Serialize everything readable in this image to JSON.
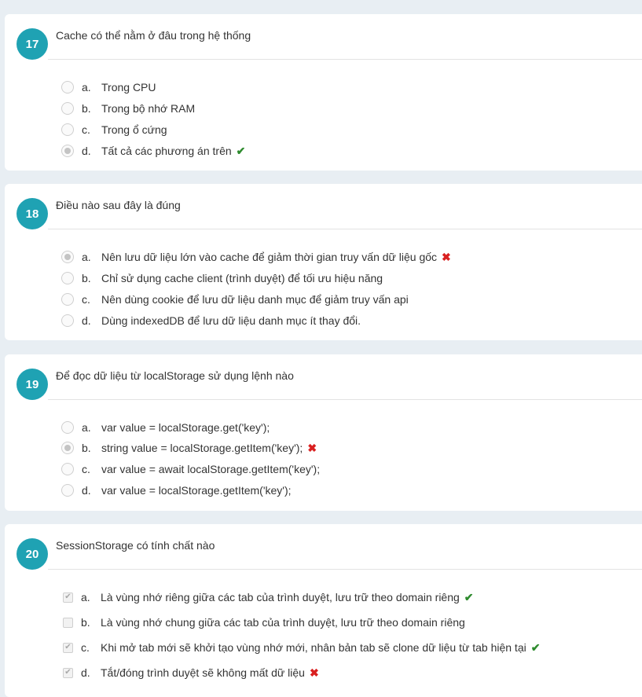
{
  "questions": [
    {
      "number": "17",
      "text": "Cache có thể nằm ở đâu trong hệ thống",
      "type": "radio",
      "options": [
        {
          "letter": "a.",
          "text": "Trong CPU",
          "checked": false,
          "mark": ""
        },
        {
          "letter": "b.",
          "text": "Trong bộ nhớ RAM",
          "checked": false,
          "mark": ""
        },
        {
          "letter": "c.",
          "text": "Trong ổ cứng",
          "checked": false,
          "mark": ""
        },
        {
          "letter": "d.",
          "text": "Tất cả các phương án trên",
          "checked": true,
          "mark": "correct"
        }
      ]
    },
    {
      "number": "18",
      "text": "Điều nào sau đây là đúng",
      "type": "radio",
      "options": [
        {
          "letter": "a.",
          "text": "Nên lưu dữ liệu lớn vào cache để giảm thời gian truy vấn dữ liệu gốc",
          "checked": true,
          "mark": "incorrect"
        },
        {
          "letter": "b.",
          "text": "Chỉ sử dụng cache client (trình duyệt) để tối ưu hiệu năng",
          "checked": false,
          "mark": ""
        },
        {
          "letter": "c.",
          "text": "Nên dùng cookie để lưu dữ liệu danh mục để giảm truy vấn api",
          "checked": false,
          "mark": ""
        },
        {
          "letter": "d.",
          "text": "Dùng indexedDB để lưu dữ liệu danh mục ít thay đổi.",
          "checked": false,
          "mark": ""
        }
      ]
    },
    {
      "number": "19",
      "text": "Để đọc dữ liệu từ localStorage sử dụng lệnh nào",
      "type": "radio",
      "options": [
        {
          "letter": "a.",
          "text": "var value = localStorage.get('key');",
          "checked": false,
          "mark": ""
        },
        {
          "letter": "b.",
          "text": "string value = localStorage.getItem('key');",
          "checked": true,
          "mark": "incorrect"
        },
        {
          "letter": "c.",
          "text": "var value = await localStorage.getItem('key');",
          "checked": false,
          "mark": ""
        },
        {
          "letter": "d.",
          "text": "var value = localStorage.getItem('key');",
          "checked": false,
          "mark": ""
        }
      ]
    },
    {
      "number": "20",
      "text": "SessionStorage có tính chất nào",
      "type": "checkbox",
      "options": [
        {
          "letter": "a.",
          "text": "Là vùng nhớ riêng giữa các tab của trình duyệt, lưu trữ theo domain riêng",
          "checked": true,
          "mark": "correct"
        },
        {
          "letter": "b.",
          "text": "Là vùng nhớ chung giữa các tab của trình duyệt, lưu trữ theo domain riêng",
          "checked": false,
          "mark": ""
        },
        {
          "letter": "c.",
          "text": "Khi mở tab mới sẽ khởi tạo vùng nhớ mới, nhân bản tab sẽ clone dữ liệu từ tab hiện tại",
          "checked": true,
          "mark": "correct"
        },
        {
          "letter": "d.",
          "text": "Tắt/đóng trình duyệt sẽ không mất dữ liệu",
          "checked": true,
          "mark": "incorrect"
        }
      ]
    }
  ],
  "icons": {
    "correct": "check-icon",
    "incorrect": "cross-icon"
  },
  "colors": {
    "number_badge": "#1fa2b3",
    "correct": "#2e8b2e",
    "incorrect": "#d92020"
  }
}
